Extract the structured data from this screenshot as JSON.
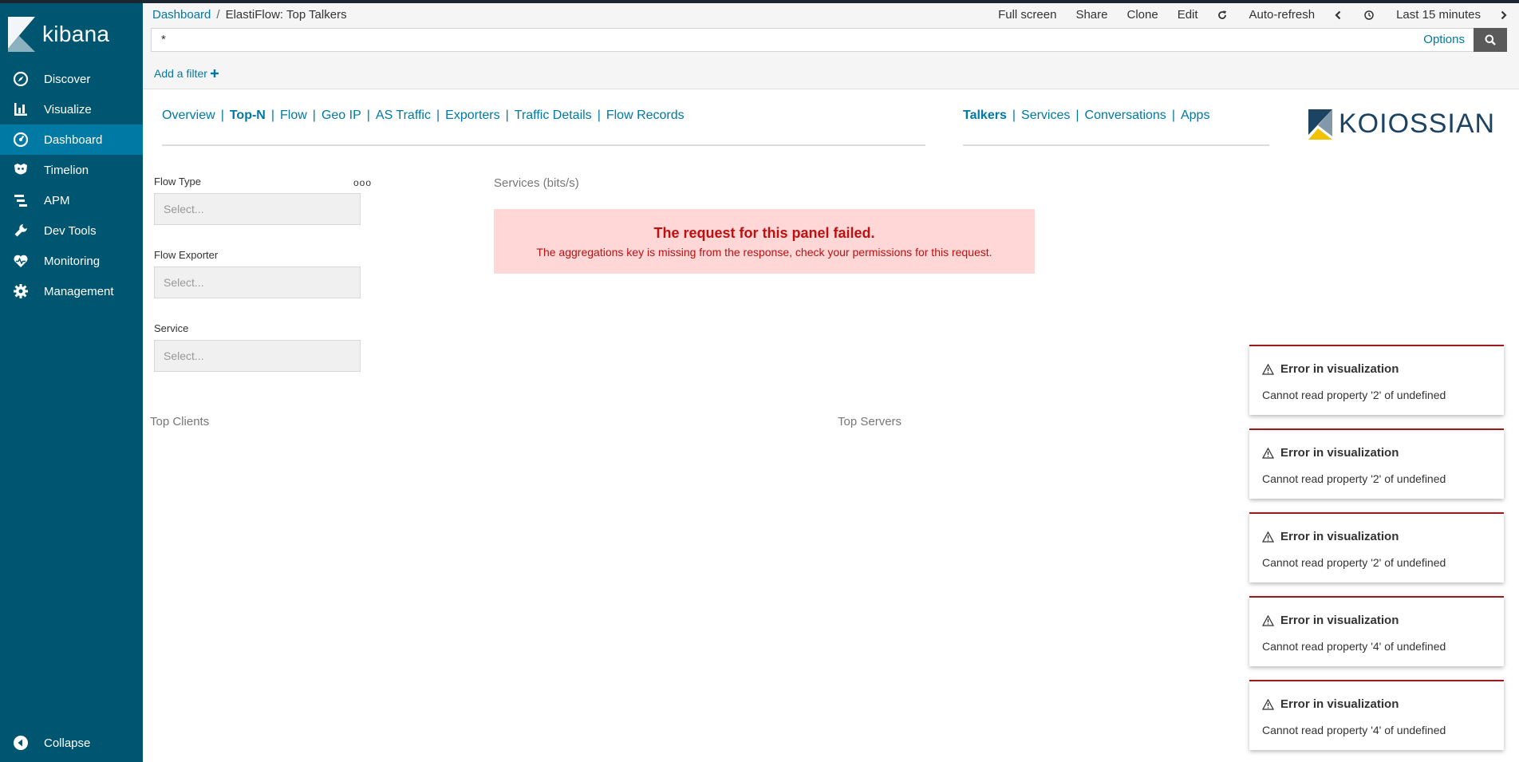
{
  "sidebar": {
    "brand": "kibana",
    "items": [
      {
        "label": "Discover",
        "icon": "compass-icon"
      },
      {
        "label": "Visualize",
        "icon": "bar-chart-icon"
      },
      {
        "label": "Dashboard",
        "icon": "dashboard-icon",
        "active": true
      },
      {
        "label": "Timelion",
        "icon": "timelion-icon"
      },
      {
        "label": "APM",
        "icon": "apm-icon"
      },
      {
        "label": "Dev Tools",
        "icon": "wrench-icon"
      },
      {
        "label": "Monitoring",
        "icon": "heartbeat-icon"
      },
      {
        "label": "Management",
        "icon": "gear-icon"
      }
    ],
    "collapse": "Collapse"
  },
  "header": {
    "breadcrumb_root": "Dashboard",
    "breadcrumb_sep": "/",
    "breadcrumb_current": "ElastiFlow: Top Talkers",
    "menu": {
      "full_screen": "Full screen",
      "share": "Share",
      "clone": "Clone",
      "edit": "Edit",
      "auto_refresh": "Auto-refresh",
      "time_range": "Last 15 minutes"
    },
    "query": {
      "value": "*",
      "options": "Options"
    },
    "add_filter": "Add a filter"
  },
  "nav_links": {
    "primary": [
      "Overview",
      "Top-N",
      "Flow",
      "Geo IP",
      "AS Traffic",
      "Exporters",
      "Traffic Details",
      "Flow Records"
    ],
    "primary_active": "Top-N",
    "secondary": [
      "Talkers",
      "Services",
      "Conversations",
      "Apps"
    ],
    "secondary_active": "Talkers",
    "separator": "|",
    "logo_text": "KOIOSSIAN"
  },
  "controls": {
    "flow_type": {
      "label": "Flow Type",
      "placeholder": "Select..."
    },
    "flow_exporter": {
      "label": "Flow Exporter",
      "placeholder": "Select..."
    },
    "service": {
      "label": "Service",
      "placeholder": "Select..."
    },
    "more": "ooo"
  },
  "panels": {
    "services_title": "Services (bits/s)",
    "error_title": "The request for this panel failed.",
    "error_message": "The aggregations key is missing from the response, check your permissions for this request.",
    "top_clients": "Top Clients",
    "top_servers": "Top Servers"
  },
  "toasts": [
    {
      "title": "Error in visualization",
      "message": "Cannot read property '2' of undefined"
    },
    {
      "title": "Error in visualization",
      "message": "Cannot read property '2' of undefined"
    },
    {
      "title": "Error in visualization",
      "message": "Cannot read property '2' of undefined"
    },
    {
      "title": "Error in visualization",
      "message": "Cannot read property '4' of undefined"
    },
    {
      "title": "Error in visualization",
      "message": "Cannot read property '4' of undefined"
    }
  ],
  "colors": {
    "sidebar": "#005571",
    "sidebar_active": "#0079a5",
    "link": "#0079a5",
    "error": "#bd1010",
    "error_bg": "#ffd7d7"
  }
}
